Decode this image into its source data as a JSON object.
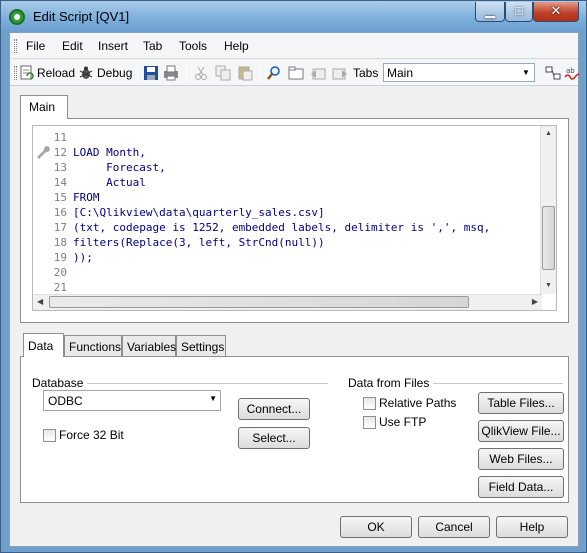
{
  "window": {
    "title": "Edit Script [QV1]"
  },
  "menu": {
    "items": [
      "File",
      "Edit",
      "Insert",
      "Tab",
      "Tools",
      "Help"
    ]
  },
  "toolbar": {
    "reload_label": "Reload",
    "debug_label": "Debug",
    "tabs_label": "Tabs",
    "tab_selected": "Main"
  },
  "editor": {
    "tab_label": "Main",
    "line_numbers": [
      "11",
      "12",
      "13",
      "14",
      "15",
      "16",
      "17",
      "18",
      "19",
      "20",
      "21"
    ],
    "lines": [
      "",
      "LOAD Month,",
      "     Forecast,",
      "     Actual",
      "FROM",
      "[C:\\Qlikview\\data\\quarterly_sales.csv]",
      "(txt, codepage is 1252, embedded labels, delimiter is ',', msq,",
      "filters(Replace(3, left, StrCnd(null))",
      "));",
      "",
      ""
    ]
  },
  "bottom_tabs": [
    "Data",
    "Functions",
    "Variables",
    "Settings"
  ],
  "data_panel": {
    "database_label": "Database",
    "database_value": "ODBC",
    "connect_label": "Connect...",
    "select_label": "Select...",
    "force32_label": "Force 32 Bit",
    "files_label": "Data from Files",
    "relative_paths_label": "Relative Paths",
    "use_ftp_label": "Use FTP",
    "table_files_label": "Table Files...",
    "qlikview_file_label": "QlikView File...",
    "web_files_label": "Web Files...",
    "field_data_label": "Field Data..."
  },
  "dialog_buttons": {
    "ok": "OK",
    "cancel": "Cancel",
    "help": "Help"
  }
}
